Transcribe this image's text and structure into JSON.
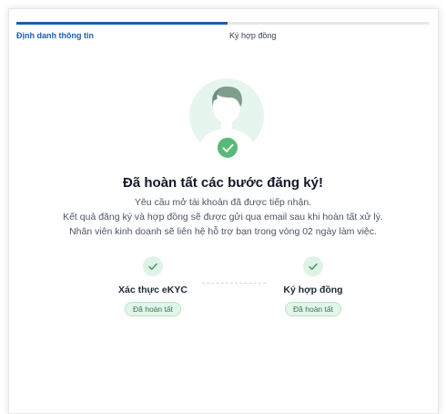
{
  "steps": [
    {
      "label": "Định danh thông tin",
      "active": true
    },
    {
      "label": "Ký hợp đồng",
      "active": false
    }
  ],
  "success": {
    "title": "Đã hoàn tất các bước đăng ký!",
    "lines": [
      "Yêu cầu mở tài khoản đã được tiếp nhận.",
      "Kết quả đăng ký và hợp đồng sẽ được gửi qua email sau khi hoàn tất xử lý.",
      "Nhân viên kinh doanh sẽ liên hệ hỗ trợ bạn trong vòng 02 ngày làm việc."
    ]
  },
  "milestones": [
    {
      "name": "Xác thực eKYC",
      "status": "Đã hoàn tất",
      "icon": "check-icon"
    },
    {
      "name": "Ký hợp đồng",
      "status": "Đã hoàn tất",
      "icon": "check-icon"
    }
  ],
  "colors": {
    "primary": "#1d5fa8",
    "success": "#58b97a",
    "success_bg": "#e3f5ea",
    "avatar_bg": "#e6f6ee"
  }
}
